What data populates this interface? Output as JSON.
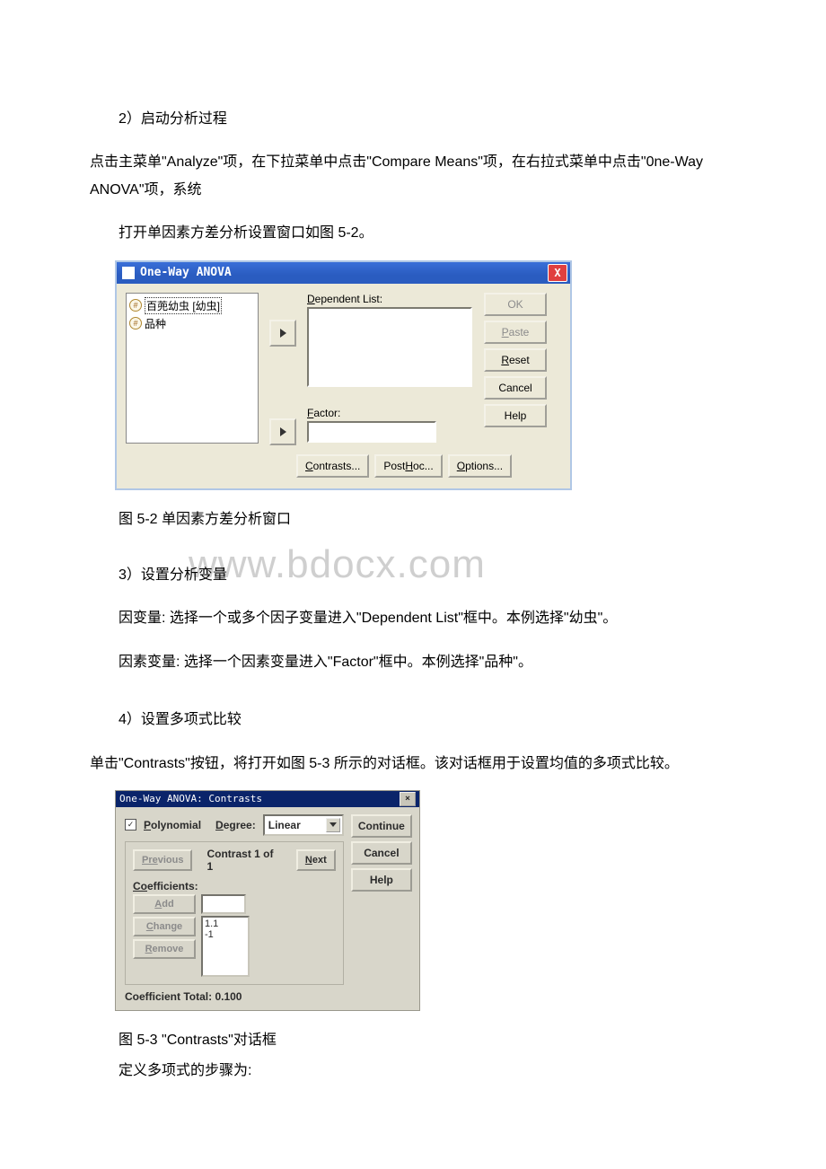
{
  "p1": "2）启动分析过程",
  "p2": "点击主菜单\"Analyze\"项，在下拉菜单中点击\"Compare Means\"项，在右拉式菜单中点击\"0ne-Way ANOVA\"项，系统",
  "p3": "打开单因素方差分析设置窗口如图 5-2。",
  "cap1": "图 5-2 单因素方差分析窗口",
  "watermark": "www.bdocx.com",
  "p4": "3）设置分析变量",
  "p5": "因变量: 选择一个或多个因子变量进入\"Dependent List\"框中。本例选择\"幼虫\"。",
  "p6": "因素变量: 选择一个因素变量进入\"Factor\"框中。本例选择\"品种\"。",
  "p7": "4）设置多项式比较",
  "p8": "单击\"Contrasts\"按钮，将打开如图 5-3 所示的对话框。该对话框用于设置均值的多项式比较。",
  "cap2": "图 5-3 \"Contrasts\"对话框",
  "p9": "定义多项式的步骤为:",
  "dlg1": {
    "title": "One-Way ANOVA",
    "src_items": [
      "百蔸幼虫 [幼虫]",
      "品种"
    ],
    "dep_label_pre": "D",
    "dep_label_rest": "ependent List:",
    "factor_label_pre": "F",
    "factor_label_rest": "actor:",
    "btn_ok": "OK",
    "btn_paste_u": "P",
    "btn_paste_rest": "aste",
    "btn_reset_u": "R",
    "btn_reset_rest": "eset",
    "btn_cancel": "Cancel",
    "btn_help": "Help",
    "fbtn_contrasts_u": "C",
    "fbtn_contrasts_rest": "ontrasts...",
    "fbtn_posthoc_pre": "Post ",
    "fbtn_posthoc_u": "H",
    "fbtn_posthoc_rest": "oc...",
    "fbtn_options_u": "O",
    "fbtn_options_rest": "ptions...",
    "close_x": "X"
  },
  "dlg2": {
    "title": "One-Way ANOVA: Contrasts",
    "close_x": "×",
    "poly_u": "P",
    "poly_rest": "olynomial",
    "degree_label_u": "D",
    "degree_label_rest": "egree:",
    "degree_value": "Linear",
    "prev_label_u": "Pre",
    "prev_label_rest": "vious",
    "contrast_of": "Contrast 1 of 1",
    "next_u": "N",
    "next_rest": "ext",
    "coef_label_u": "Co",
    "coef_label_rest": "efficients:",
    "btn_add_u": "A",
    "btn_add_rest": "dd",
    "btn_change_u": "C",
    "btn_change_rest": "hange",
    "btn_remove_u": "R",
    "btn_remove_rest": "emove",
    "coef_values": [
      "1.1",
      "-1"
    ],
    "total_label": "Coefficient Total: 0.100",
    "btn_continue": "Continue",
    "btn_cancel": "Cancel",
    "btn_help": "Help"
  }
}
